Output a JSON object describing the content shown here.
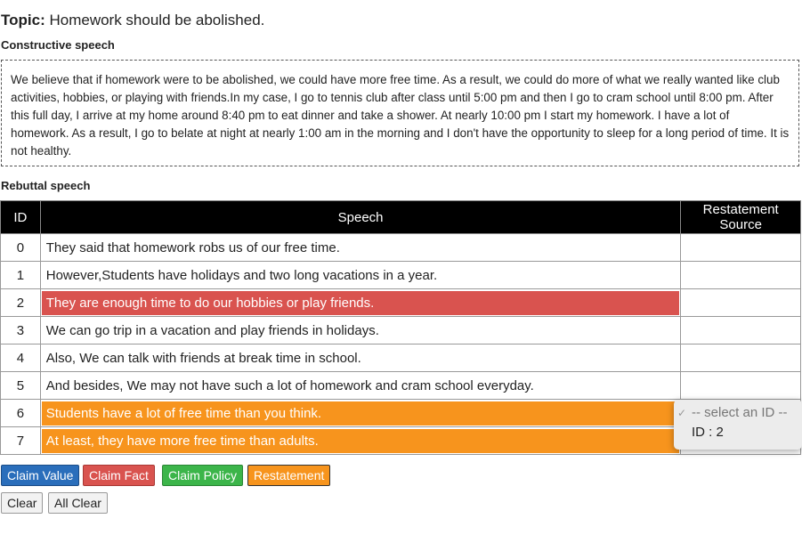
{
  "topic": {
    "prefix": "Topic:",
    "text": "Homework should be abolished."
  },
  "constructive": {
    "label": "Constructive speech",
    "text": "We believe that if homework were to be abolished, we could have more free time. As a result, we could do more of what we really wanted like club activities, hobbies, or playing with friends.In my case, I go to tennis club after class until 5:00 pm and then I go to cram school until 8:00 pm. After this full day, I arrive at my home around 8:40 pm to eat dinner and take a shower. At nearly 10:00 pm I start my homework. I have a lot of homework. As a result, I go to belate at night at nearly 1:00 am in the morning and I don't have the opportunity to sleep for a long period of time. It is not healthy."
  },
  "rebuttal": {
    "label": "Rebuttal speech",
    "columns": [
      "ID",
      "Speech",
      "Restatement Source"
    ],
    "rows": [
      {
        "id": "0",
        "speech": "They said that homework robs us of our free time.",
        "highlight": "none"
      },
      {
        "id": "1",
        "speech": "However,Students have holidays and two long vacations in a year.",
        "highlight": "none"
      },
      {
        "id": "2",
        "speech": "They are enough time to do our hobbies or play friends.",
        "highlight": "claim-fact"
      },
      {
        "id": "3",
        "speech": "We can go trip in a vacation and play friends in holidays.",
        "highlight": "none"
      },
      {
        "id": "4",
        "speech": "Also, We can talk with friends at break time in school.",
        "highlight": "none"
      },
      {
        "id": "5",
        "speech": "And besides, We may not have such a lot of homework and cram school everyday.",
        "highlight": "none"
      },
      {
        "id": "6",
        "speech": "Students have a lot of free time than you think.",
        "highlight": "restatement"
      },
      {
        "id": "7",
        "speech": "At least, they have more free time than adults.",
        "highlight": "restatement"
      }
    ]
  },
  "source_dropdown": {
    "options": [
      "-- select an ID --",
      "ID : 2"
    ],
    "selected": "-- select an ID --"
  },
  "buttons": {
    "claim_value": "Claim Value",
    "claim_fact": "Claim Fact",
    "claim_policy": "Claim Policy",
    "restatement": "Restatement",
    "clear": "Clear",
    "all_clear": "All Clear"
  },
  "colors": {
    "claim_value": "#2a6ebb",
    "claim_fact": "#d9534f",
    "claim_policy": "#3cb54a",
    "restatement": "#f7941d"
  }
}
